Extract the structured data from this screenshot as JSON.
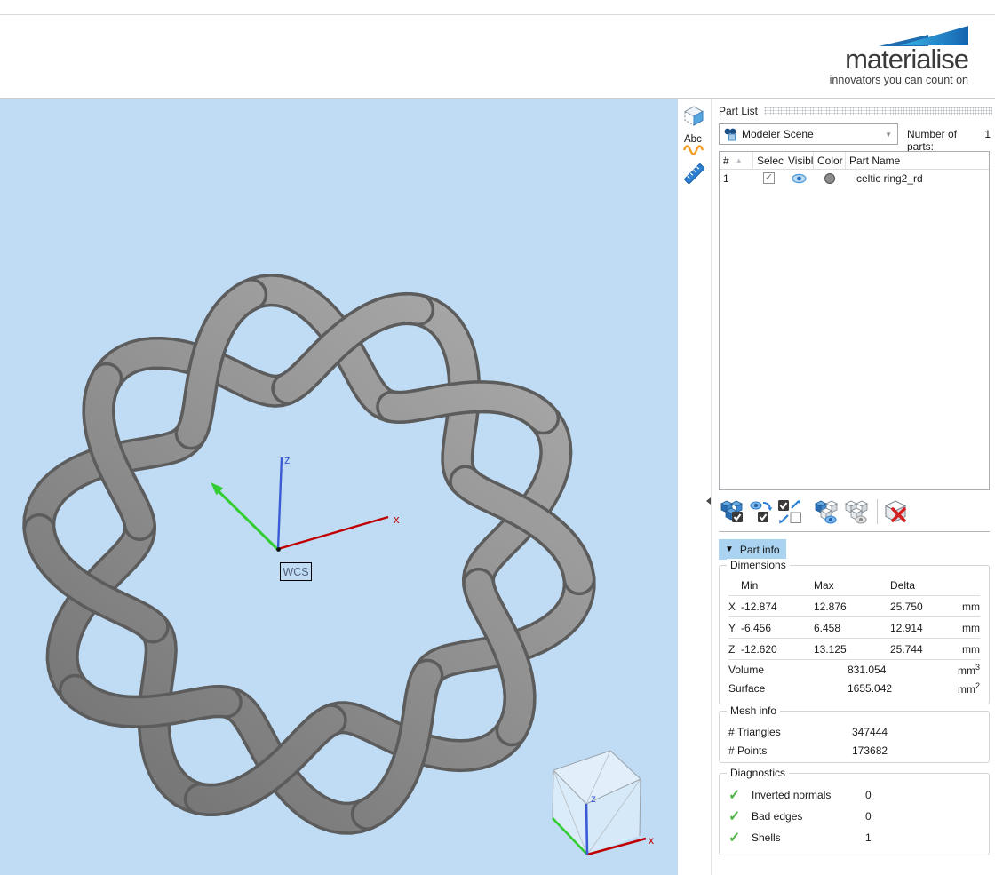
{
  "header": {
    "logo_word": "materialise",
    "tagline": "innovators you can count on",
    "brand_colors": {
      "swoosh_dark": "#1f6cb0",
      "swoosh_light_from": "#3ab3e8",
      "swoosh_light_to": "#1565ae"
    }
  },
  "side_toolbar": {
    "icons": [
      "view-cube-icon",
      "annotate-icon",
      "measure-icon"
    ]
  },
  "part_list": {
    "title": "Part List",
    "scene_selector": {
      "value": "Modeler Scene"
    },
    "number_of_parts_label": "Number of parts:",
    "number_of_parts": "1",
    "columns": {
      "index": "#",
      "select": "Select",
      "visible": "Visibl",
      "color": "Color",
      "name": "Part Name"
    },
    "rows": [
      {
        "index": "1",
        "selected": true,
        "visible": true,
        "color": "#8c8c8c",
        "name": "celtic ring2_rd"
      }
    ]
  },
  "part_toolbar": {
    "icons": [
      "select-all-parts-icon",
      "select-visible-icon",
      "invert-selection-icon",
      "show-selected-icon",
      "hide-selected-icon",
      "delete-part-icon"
    ]
  },
  "part_info": {
    "button_label": "Part info",
    "dimensions": {
      "title": "Dimensions",
      "headers": {
        "min": "Min",
        "max": "Max",
        "delta": "Delta"
      },
      "rows": [
        {
          "axis": "X",
          "min": "-12.874",
          "max": "12.876",
          "delta": "25.750",
          "unit": "mm"
        },
        {
          "axis": "Y",
          "min": "-6.456",
          "max": "6.458",
          "delta": "12.914",
          "unit": "mm"
        },
        {
          "axis": "Z",
          "min": "-12.620",
          "max": "13.125",
          "delta": "25.744",
          "unit": "mm"
        }
      ],
      "volume": {
        "label": "Volume",
        "value": "831.054",
        "unit": "mm",
        "sup": "3"
      },
      "surface": {
        "label": "Surface",
        "value": "1655.042",
        "unit": "mm",
        "sup": "2"
      }
    },
    "mesh_info": {
      "title": "Mesh info",
      "rows": [
        {
          "label": "# Triangles",
          "value": "347444"
        },
        {
          "label": "# Points",
          "value": "173682"
        }
      ]
    },
    "diagnostics": {
      "title": "Diagnostics",
      "check_glyph": "✓",
      "rows": [
        {
          "label": "Inverted normals",
          "value": "0"
        },
        {
          "label": "Bad edges",
          "value": "0"
        },
        {
          "label": "Shells",
          "value": "1"
        }
      ]
    }
  },
  "glyphs": {
    "dropdown_arrow": "▼",
    "sort_arrow": "▲",
    "checkbox_check": "✓",
    "part_info_arrow": "▼"
  },
  "viewport": {
    "wcs_label": "WCS",
    "axis_labels": {
      "x": "x",
      "z": "z"
    },
    "nav_cube_labels": {
      "x": "x",
      "z": "z"
    },
    "colors": {
      "background": "#bfdcf4",
      "x_axis": "#c00000",
      "y_axis": "#33cc33",
      "z_axis": "#3b5bd6",
      "ring_mid": "#8e8e8e",
      "ring_edge": "#5c5c5c"
    }
  }
}
